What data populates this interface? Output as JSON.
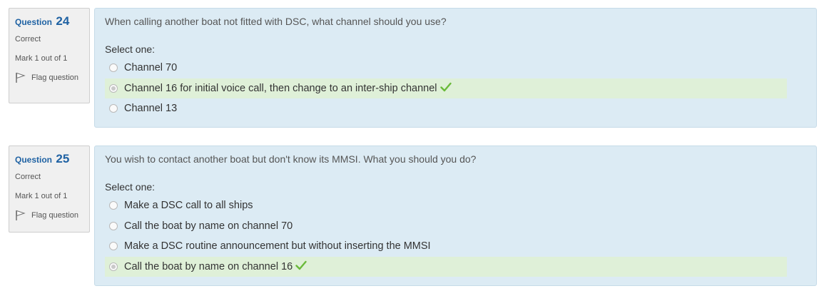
{
  "questions": [
    {
      "label": "Question",
      "number": "24",
      "state": "Correct",
      "grade": "Mark 1 out of 1",
      "flag_label": "Flag question",
      "text": "When calling another boat not fitted with DSC, what channel should you use?",
      "prompt": "Select one:",
      "options": [
        {
          "label": "Channel 70",
          "selected": false,
          "correct": false
        },
        {
          "label": "Channel 16 for initial voice call, then change to an inter-ship channel",
          "selected": true,
          "correct": true
        },
        {
          "label": "Channel 13",
          "selected": false,
          "correct": false
        }
      ]
    },
    {
      "label": "Question",
      "number": "25",
      "state": "Correct",
      "grade": "Mark 1 out of 1",
      "flag_label": "Flag question",
      "text": "You wish to contact another boat but don't know its MMSI. What you should you do?",
      "prompt": "Select one:",
      "options": [
        {
          "label": "Make a DSC call to all ships",
          "selected": false,
          "correct": false
        },
        {
          "label": "Call the boat by name on channel 70",
          "selected": false,
          "correct": false
        },
        {
          "label": "Make a DSC routine announcement but without inserting the MMSI",
          "selected": false,
          "correct": false
        },
        {
          "label": "Call the boat by name on channel 16",
          "selected": true,
          "correct": true
        }
      ]
    }
  ],
  "colors": {
    "question_number": "#1f62a3",
    "content_bg": "#dcebf4",
    "correct_bg": "#dff0d8",
    "check": "#5cb85c"
  }
}
